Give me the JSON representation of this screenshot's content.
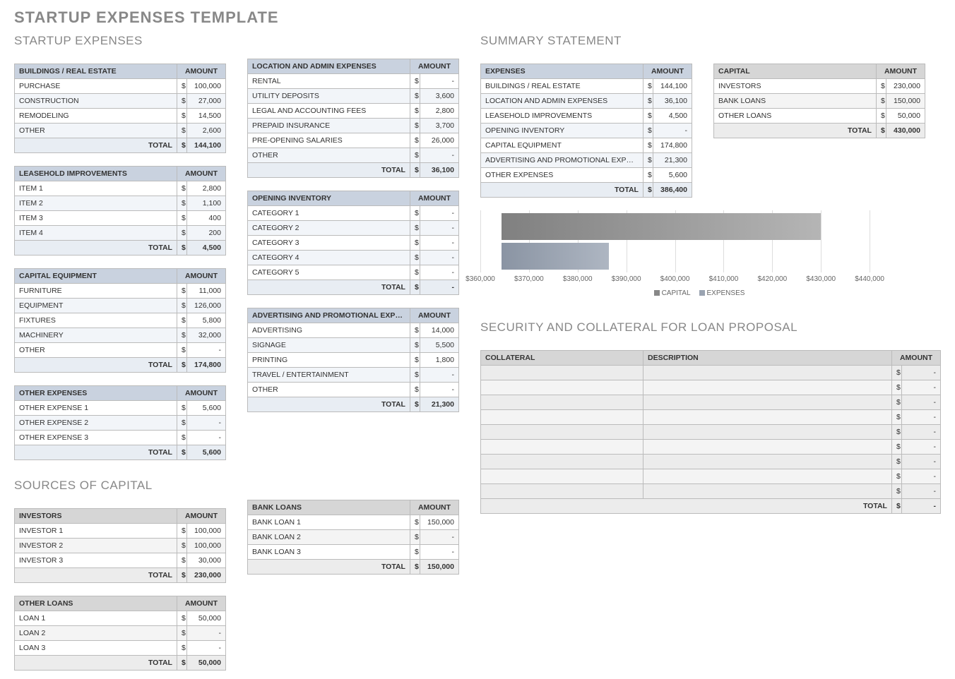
{
  "page_title": "STARTUP EXPENSES TEMPLATE",
  "amt_header": "AMOUNT",
  "total_label": "TOTAL",
  "sections": {
    "startup_expenses": "STARTUP EXPENSES",
    "sources_of_capital": "SOURCES OF CAPITAL",
    "summary_statement": "SUMMARY STATEMENT",
    "security": "SECURITY AND COLLATERAL FOR LOAN PROPOSAL"
  },
  "tables": {
    "buildings": {
      "title": "BUILDINGS / REAL ESTATE",
      "rows": [
        [
          "PURCHASE",
          "100,000"
        ],
        [
          "CONSTRUCTION",
          "27,000"
        ],
        [
          "REMODELING",
          "14,500"
        ],
        [
          "OTHER",
          "2,600"
        ]
      ],
      "total": "144,100"
    },
    "leasehold": {
      "title": "LEASEHOLD IMPROVEMENTS",
      "rows": [
        [
          "ITEM 1",
          "2,800"
        ],
        [
          "ITEM 2",
          "1,100"
        ],
        [
          "ITEM 3",
          "400"
        ],
        [
          "ITEM 4",
          "200"
        ]
      ],
      "total": "4,500"
    },
    "capital_eq": {
      "title": "CAPITAL EQUIPMENT",
      "rows": [
        [
          "FURNITURE",
          "11,000"
        ],
        [
          "EQUIPMENT",
          "126,000"
        ],
        [
          "FIXTURES",
          "5,800"
        ],
        [
          "MACHINERY",
          "32,000"
        ],
        [
          "OTHER",
          "-"
        ]
      ],
      "total": "174,800"
    },
    "other_exp": {
      "title": "OTHER EXPENSES",
      "rows": [
        [
          "OTHER EXPENSE 1",
          "5,600"
        ],
        [
          "OTHER EXPENSE 2",
          "-"
        ],
        [
          "OTHER EXPENSE 3",
          "-"
        ]
      ],
      "total": "5,600"
    },
    "location": {
      "title": "LOCATION AND ADMIN EXPENSES",
      "rows": [
        [
          "RENTAL",
          "-"
        ],
        [
          "UTILITY DEPOSITS",
          "3,600"
        ],
        [
          "LEGAL AND ACCOUNTING FEES",
          "2,800"
        ],
        [
          "PREPAID INSURANCE",
          "3,700"
        ],
        [
          "PRE-OPENING SALARIES",
          "26,000"
        ],
        [
          "OTHER",
          "-"
        ]
      ],
      "total": "36,100"
    },
    "inventory": {
      "title": "OPENING INVENTORY",
      "rows": [
        [
          "CATEGORY 1",
          "-"
        ],
        [
          "CATEGORY 2",
          "-"
        ],
        [
          "CATEGORY 3",
          "-"
        ],
        [
          "CATEGORY 4",
          "-"
        ],
        [
          "CATEGORY 5",
          "-"
        ]
      ],
      "total": "-"
    },
    "adv": {
      "title": "ADVERTISING AND PROMOTIONAL EXPENSES",
      "rows": [
        [
          "ADVERTISING",
          "14,000"
        ],
        [
          "SIGNAGE",
          "5,500"
        ],
        [
          "PRINTING",
          "1,800"
        ],
        [
          "TRAVEL / ENTERTAINMENT",
          "-"
        ],
        [
          "OTHER",
          "-"
        ]
      ],
      "total": "21,300"
    },
    "investors": {
      "title": "INVESTORS",
      "rows": [
        [
          "INVESTOR 1",
          "100,000"
        ],
        [
          "INVESTOR 2",
          "100,000"
        ],
        [
          "INVESTOR 3",
          "30,000"
        ]
      ],
      "total": "230,000"
    },
    "other_loans": {
      "title": "OTHER LOANS",
      "rows": [
        [
          "LOAN 1",
          "50,000"
        ],
        [
          "LOAN 2",
          "-"
        ],
        [
          "LOAN 3",
          "-"
        ]
      ],
      "total": "50,000"
    },
    "bank_loans": {
      "title": "BANK LOANS",
      "rows": [
        [
          "BANK LOAN 1",
          "150,000"
        ],
        [
          "BANK LOAN 2",
          "-"
        ],
        [
          "BANK LOAN 3",
          "-"
        ]
      ],
      "total": "150,000"
    },
    "summary_exp": {
      "title": "EXPENSES",
      "rows": [
        [
          "BUILDINGS / REAL ESTATE",
          "144,100"
        ],
        [
          "LOCATION AND ADMIN EXPENSES",
          "36,100"
        ],
        [
          "LEASEHOLD IMPROVEMENTS",
          "4,500"
        ],
        [
          "OPENING INVENTORY",
          "-"
        ],
        [
          "CAPITAL EQUIPMENT",
          "174,800"
        ],
        [
          "ADVERTISING AND PROMOTIONAL EXPENSES",
          "21,300"
        ],
        [
          "OTHER EXPENSES",
          "5,600"
        ]
      ],
      "total": "386,400"
    },
    "summary_cap": {
      "title": "CAPITAL",
      "rows": [
        [
          "INVESTORS",
          "230,000"
        ],
        [
          "BANK LOANS",
          "150,000"
        ],
        [
          "OTHER LOANS",
          "50,000"
        ]
      ],
      "total": "430,000"
    }
  },
  "collateral": {
    "headers": [
      "COLLATERAL",
      "DESCRIPTION",
      "AMOUNT"
    ],
    "rows": [
      [
        "",
        "",
        "-"
      ],
      [
        "",
        "",
        "-"
      ],
      [
        "",
        "",
        "-"
      ],
      [
        "",
        "",
        "-"
      ],
      [
        "",
        "",
        "-"
      ],
      [
        "",
        "",
        "-"
      ],
      [
        "",
        "",
        "-"
      ],
      [
        "",
        "",
        "-"
      ],
      [
        "",
        "",
        "-"
      ]
    ],
    "total": "-"
  },
  "chart_data": {
    "type": "bar",
    "orientation": "horizontal",
    "series": [
      {
        "name": "CAPITAL",
        "value": 430000
      },
      {
        "name": "EXPENSES",
        "value": 386400
      }
    ],
    "xlim": [
      360000,
      450000
    ],
    "ticks": [
      "$360,000",
      "$370,000",
      "$380,000",
      "$390,000",
      "$400,000",
      "$410,000",
      "$420,000",
      "$430,000",
      "$440,000"
    ],
    "legend": [
      "CAPITAL",
      "EXPENSES"
    ]
  }
}
